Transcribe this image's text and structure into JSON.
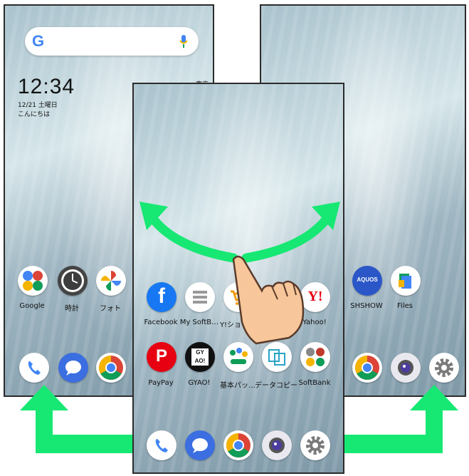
{
  "left_screen": {
    "search": {
      "google_glyph": "G"
    },
    "clock": {
      "time": "12:34",
      "date": "12/21 土曜日",
      "greeting": "こんにちは"
    },
    "weather": "東京",
    "apps": [
      {
        "label": "Google",
        "icon": "google-folder-icon"
      },
      {
        "label": "時計",
        "icon": "clock-icon"
      },
      {
        "label": "フォト",
        "icon": "photos-icon"
      }
    ],
    "dock": [
      "phone-icon",
      "softbank-message-icon",
      "chrome-icon"
    ]
  },
  "center_screen": {
    "apps_row1": [
      {
        "label": "Facebook",
        "icon": "facebook-icon"
      },
      {
        "label": "My SoftB…",
        "icon": "my-softbank-icon"
      },
      {
        "label": "Y!ショッ…",
        "icon": "yahoo-shopping-icon"
      },
      {
        "label": "Yahoo!",
        "icon": "yahoo-icon"
      }
    ],
    "apps_row2": [
      {
        "label": "PayPay",
        "icon": "paypay-icon"
      },
      {
        "label": "GYAO!",
        "icon": "gyao-icon"
      },
      {
        "label": "基本パッ…",
        "icon": "kihon-pack-icon"
      },
      {
        "label": "データコピー",
        "icon": "data-copy-icon"
      },
      {
        "label": "SoftBank",
        "icon": "softbank-folder-icon"
      }
    ],
    "dock": [
      "phone-icon",
      "softbank-message-icon",
      "chrome-icon",
      "camera-icon",
      "settings-icon"
    ]
  },
  "right_screen": {
    "apps": [
      {
        "label": "SHSHOW",
        "icon": "aquos-shshow-icon",
        "text": "AQUOS"
      },
      {
        "label": "Files",
        "icon": "files-icon"
      }
    ],
    "dock": [
      "chrome-icon",
      "camera-icon",
      "settings-icon"
    ]
  },
  "colors": {
    "arrow_green": "#17e873",
    "chrome_red": "#db4437",
    "chrome_yellow": "#f4b400",
    "chrome_green": "#0f9d58",
    "chrome_blue": "#4285f4"
  }
}
